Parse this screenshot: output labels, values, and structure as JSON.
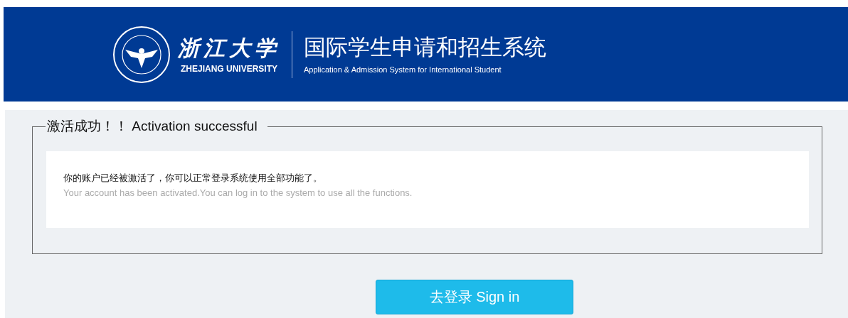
{
  "header": {
    "logo_chinese": "浙江大学",
    "logo_english": "ZHEJIANG UNIVERSITY",
    "system_title": "国际学生申请和招生系统",
    "system_subtitle": "Application & Admission System for International Student"
  },
  "notice": {
    "legend": "激活成功！！ Activation successful",
    "message_chinese": "你的账户已经被激活了，你可以正常登录系统使用全部功能了。",
    "message_english": "Your account has been activated.You can log in to the system to use all the functions."
  },
  "button": {
    "label": "去登录 Sign in"
  }
}
